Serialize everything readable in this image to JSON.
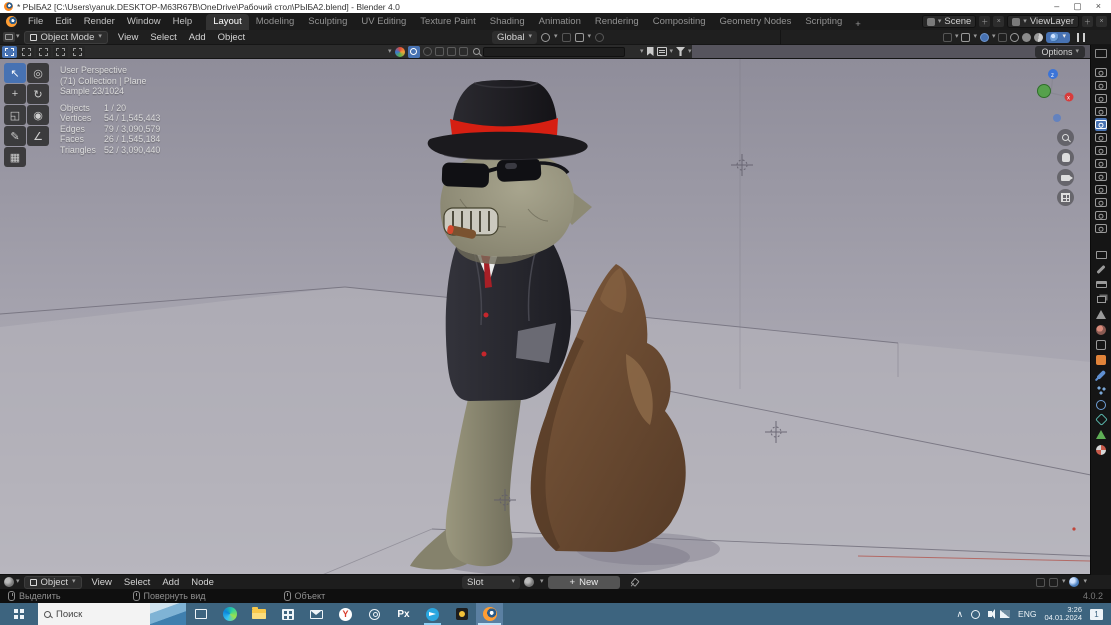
{
  "titlebar": {
    "title": "* РЫБА2 [C:\\Users\\yanuk.DESKTOP-M63R67B\\OneDrive\\Рабочий стол\\РЫБА2.blend] - Blender 4.0",
    "minimize": "–",
    "maximize": "▢",
    "close": "×"
  },
  "menubar": {
    "items": [
      "File",
      "Edit",
      "Render",
      "Window",
      "Help"
    ]
  },
  "workspaces": {
    "tabs": [
      "Layout",
      "Modeling",
      "Sculpting",
      "UV Editing",
      "Texture Paint",
      "Shading",
      "Animation",
      "Rendering",
      "Compositing",
      "Geometry Nodes",
      "Scripting"
    ],
    "active": "Layout",
    "add": "+"
  },
  "topbar_right": {
    "scene": "Scene",
    "view_layer": "ViewLayer"
  },
  "vheader": {
    "mode": "Object Mode",
    "menus": [
      "View",
      "Select",
      "Add",
      "Object"
    ],
    "orientation": "Global",
    "options": "Options"
  },
  "overlay": {
    "view": "User Perspective",
    "collection": "(71) Collection | Plane",
    "sample": "Sample 23/1024",
    "stats": [
      {
        "label": "Objects",
        "value": "1 / 20"
      },
      {
        "label": "Vertices",
        "value": "54 / 1,545,443"
      },
      {
        "label": "Edges",
        "value": "79 / 3,090,579"
      },
      {
        "label": "Faces",
        "value": "26 / 1,545,184"
      },
      {
        "label": "Triangles",
        "value": "52 / 3,090,440"
      }
    ]
  },
  "node_editor": {
    "mode": "Object",
    "menus": [
      "View",
      "Select",
      "Add",
      "Node"
    ],
    "slot": "Slot",
    "plus": "+",
    "new_button": "New"
  },
  "status": {
    "hints": [
      "Выделить",
      "Повернуть вид",
      "Объект"
    ],
    "version": "4.0.2"
  },
  "taskbar": {
    "search": "Поиск",
    "lang": "ENG",
    "time": "3:26",
    "date": "04.01.2024",
    "badge": "1"
  },
  "icons": {
    "caret": "▾",
    "chevron_up": "∧"
  },
  "colors": {
    "accent_blue": "#4772b3",
    "taskbar_blue": "#3d647f",
    "viewport_top": "#8f8d9a",
    "viewport_bottom": "#bab8c0",
    "rock_brown": "#7e5a3c",
    "hat_band_red": "#d61f12"
  }
}
